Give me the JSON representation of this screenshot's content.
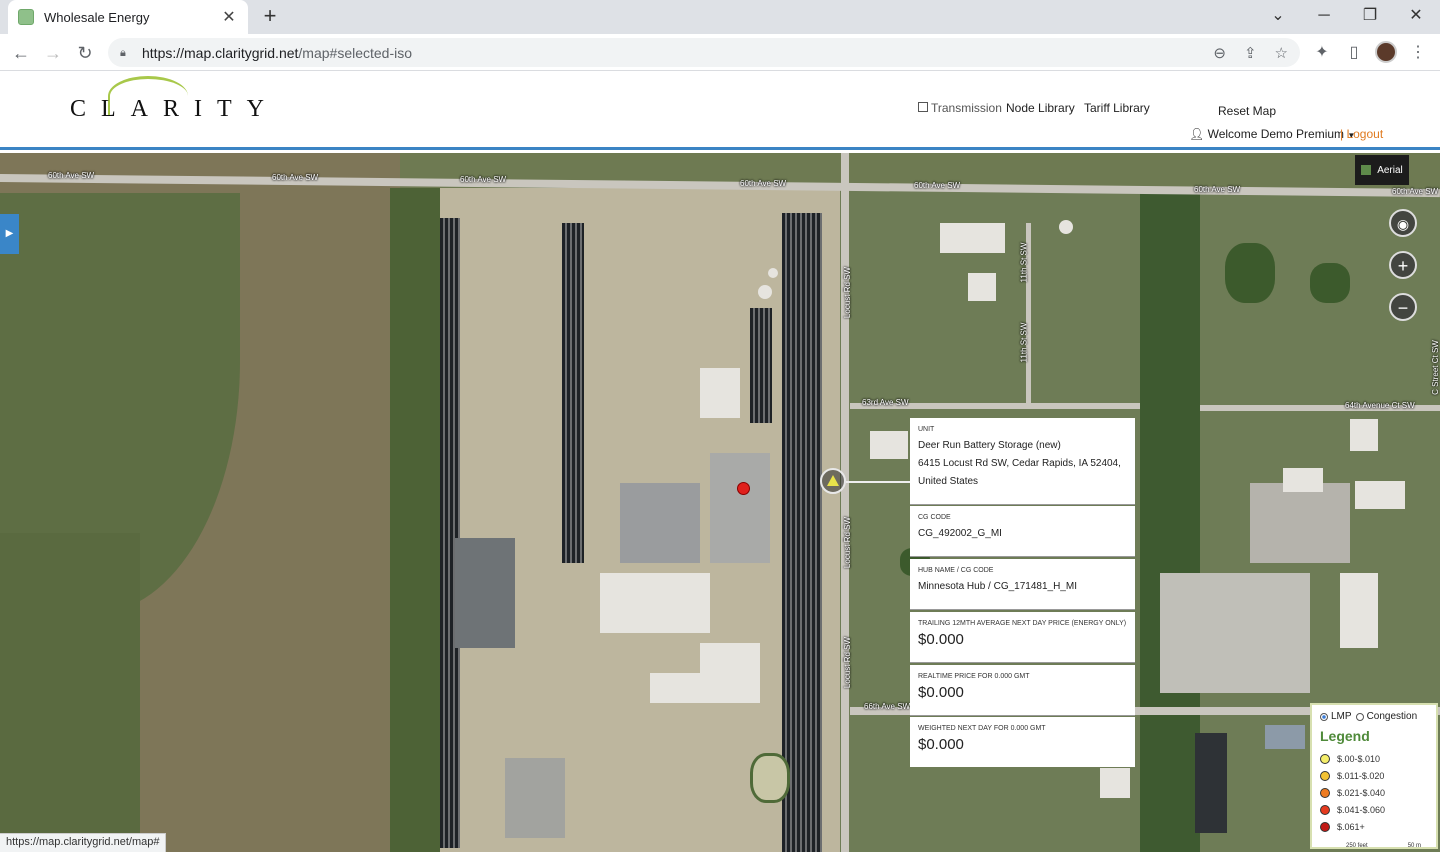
{
  "browser": {
    "tab_title": "Wholesale Energy",
    "url_host": "https://map.claritygrid.net",
    "url_path": "/map#selected-iso",
    "status_url": "https://map.claritygrid.net/map#"
  },
  "header": {
    "logo_text": "CLARITY",
    "transmission_label": "Transmission",
    "node_library": "Node Library",
    "tariff_library": "Tariff Library",
    "reset_map": "Reset Map",
    "welcome": "Welcome Demo Premium",
    "logout": "| Logout"
  },
  "map": {
    "aerial_label": "Aerial",
    "roads": {
      "r1": "60th Ave SW",
      "r2": "60th Ave SW",
      "r3": "60th Ave SW",
      "r4": "60th Ave SW",
      "r5": "60th Ave SW",
      "r6": "60th Ave SW",
      "r7": "60th Ave SW",
      "locust1": "Locust Rd SW",
      "locust2": "Locust Rd SW",
      "locust3": "Locust Rd SW",
      "s1": "11th St SW",
      "s2": "11th St SW",
      "ave63": "63rd Ave SW",
      "ave64": "64th Avenue Ct SW",
      "ave66": "66th Ave SW",
      "street_ct": "C Street Ct SW"
    }
  },
  "popup": {
    "unit_label": "UNIT",
    "unit_name": "Deer Run Battery Storage (new)",
    "unit_addr1": "6415 Locust Rd SW, Cedar Rapids, IA 52404,",
    "unit_addr2": "United States",
    "cg_label": "CG CODE",
    "cg_value": "CG_492002_G_MI",
    "hub_label": "HUB Name / CG CODE",
    "hub_value": "Minnesota Hub / CG_171481_H_MI",
    "trailing_label": "TRAILING 12mth AVERAGE NEXT DAY PRICE (Energy only)",
    "trailing_value": "$0.000",
    "realtime_label": "REALTIME PRICE FOR 0.000 GMT",
    "realtime_value": "$0.000",
    "weighted_label": "WEIGHTED NEXT DAY FOR 0.000 GMT",
    "weighted_value": "$0.000"
  },
  "legend": {
    "mode_lmp": "LMP",
    "mode_congestion": "Congestion",
    "title": "Legend",
    "items": [
      {
        "label": "$.00-$.010",
        "color": "#f5ee6a"
      },
      {
        "label": "$.011-$.020",
        "color": "#f2c233"
      },
      {
        "label": "$.021-$.040",
        "color": "#ee7b22"
      },
      {
        "label": "$.041-$.060",
        "color": "#e53a1f"
      },
      {
        "label": "$.061+",
        "color": "#c11a16"
      }
    ],
    "scale_feet": "250 feet",
    "scale_m": "50 m"
  }
}
